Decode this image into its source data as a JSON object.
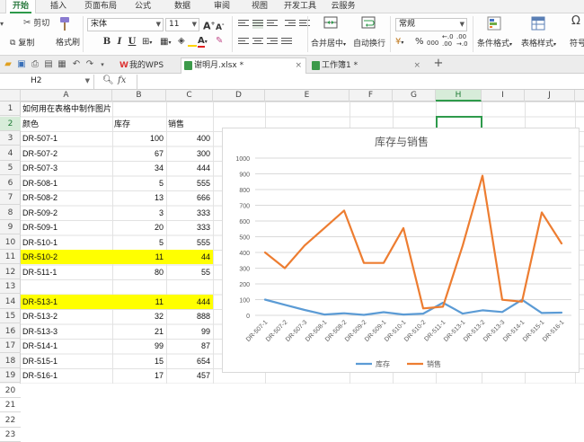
{
  "menu": {
    "tabs": [
      {
        "label": "开始",
        "active": true
      },
      {
        "label": "插入"
      },
      {
        "label": "页面布局"
      },
      {
        "label": "公式"
      },
      {
        "label": "数据"
      },
      {
        "label": "审阅"
      },
      {
        "label": "视图"
      },
      {
        "label": "开发工具"
      },
      {
        "label": "云服务"
      }
    ]
  },
  "ribbon": {
    "cut": "剪切",
    "paste": "粘贴",
    "copy": "复制",
    "format_painter": "格式刷",
    "font_name": "宋体",
    "font_size": "11",
    "bold": "B",
    "italic": "I",
    "underline": "U",
    "merge_center": "合并居中",
    "wrap_text": "自动换行",
    "number_format": "常规",
    "conditional_format": "条件格式",
    "table_style": "表格样式",
    "symbol": "符号",
    "percent": "%",
    "thousands": "000"
  },
  "tabbar": {
    "my_wps": "我的WPS",
    "docs": [
      {
        "label": "谢明月.xlsx *",
        "active": true,
        "color": "#3c9a4a"
      },
      {
        "label": "工作簿1 *",
        "active": false,
        "color": "#3c9a4a"
      }
    ],
    "add": "+"
  },
  "formula_bar": {
    "name_box": "H2",
    "fx": "fx",
    "zoom_icon": "magnifier-icon"
  },
  "columns": [
    "A",
    "B",
    "C",
    "D",
    "E",
    "F",
    "G",
    "H",
    "I",
    "J"
  ],
  "selected_column": "H",
  "rows": [
    "1",
    "2",
    "3",
    "4",
    "5",
    "6",
    "7",
    "8",
    "9",
    "10",
    "11",
    "12",
    "13",
    "14",
    "15",
    "16",
    "17",
    "18",
    "19",
    "20",
    "21",
    "22",
    "23"
  ],
  "selected_row": "2",
  "sheet": {
    "title": "如何用在表格中制作图片",
    "headers": {
      "a": "颜色",
      "b": "库存",
      "c": "销售"
    },
    "data_rows": [
      {
        "row": "3",
        "a": "DR-507-1",
        "b": "100",
        "c": "400"
      },
      {
        "row": "4",
        "a": "DR-507-2",
        "b": "67",
        "c": "300"
      },
      {
        "row": "5",
        "a": "DR-507-3",
        "b": "34",
        "c": "444"
      },
      {
        "row": "6",
        "a": "DR-508-1",
        "b": "5",
        "c": "555"
      },
      {
        "row": "7",
        "a": "DR-508-2",
        "b": "13",
        "c": "666"
      },
      {
        "row": "8",
        "a": "DR-509-2",
        "b": "3",
        "c": "333"
      },
      {
        "row": "9",
        "a": "DR-509-1",
        "b": "20",
        "c": "333"
      },
      {
        "row": "10",
        "a": "DR-510-1",
        "b": "5",
        "c": "555"
      },
      {
        "row": "11",
        "a": "DR-510-2",
        "b": "11",
        "c": "44",
        "highlight": true
      },
      {
        "row": "12",
        "a": "DR-511-1",
        "b": "80",
        "c": "55"
      },
      {
        "row": "14",
        "a": "DR-513-1",
        "b": "11",
        "c": "444",
        "highlight": true
      },
      {
        "row": "15",
        "a": "DR-513-2",
        "b": "32",
        "c": "888"
      },
      {
        "row": "16",
        "a": "DR-513-3",
        "b": "21",
        "c": "99"
      },
      {
        "row": "17",
        "a": "DR-514-1",
        "b": "99",
        "c": "87"
      },
      {
        "row": "18",
        "a": "DR-515-1",
        "b": "15",
        "c": "654"
      },
      {
        "row": "19",
        "a": "DR-516-1",
        "b": "17",
        "c": "457"
      }
    ]
  },
  "colors": {
    "accent": "#2e9a4b",
    "highlight": "#ffff00",
    "series_stock": "#5b9bd5",
    "series_sales": "#ed7d31"
  },
  "chart_data": {
    "type": "line",
    "title": "库存与销售",
    "categories": [
      "DR-507-1",
      "DR-507-2",
      "DR-507-3",
      "DR-508-1",
      "DR-508-2",
      "DR-509-2",
      "DR-509-1",
      "DR-510-1",
      "DR-510-2",
      "DR-511-1",
      "DR-513-1",
      "DR-513-2",
      "DR-513-3",
      "DR-514-1",
      "DR-515-1",
      "DR-516-1"
    ],
    "series": [
      {
        "name": "库存",
        "color": "#5b9bd5",
        "values": [
          100,
          67,
          34,
          5,
          13,
          3,
          20,
          5,
          11,
          80,
          11,
          32,
          21,
          99,
          15,
          17
        ]
      },
      {
        "name": "销售",
        "color": "#ed7d31",
        "values": [
          400,
          300,
          444,
          555,
          666,
          333,
          333,
          555,
          44,
          55,
          444,
          888,
          99,
          87,
          654,
          457
        ]
      }
    ],
    "yticks": [
      "0",
      "100",
      "200",
      "300",
      "400",
      "500",
      "600",
      "700",
      "800",
      "900",
      "1000"
    ],
    "ylim": [
      0,
      1000
    ],
    "grid": true,
    "legend": "bottom"
  }
}
